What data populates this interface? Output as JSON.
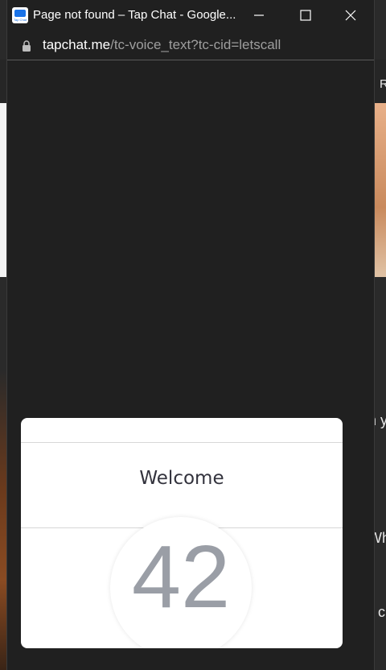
{
  "window": {
    "title": "Page not found – Tap Chat - Google...",
    "favicon_text": "Tap Chat"
  },
  "address": {
    "host": "tapchat.me",
    "path": "/tc-voice_text?tc-cid=letscall"
  },
  "background_page": {
    "snippet_1": "R",
    "snippet_2": "n y",
    "snippet_3": "Wh",
    "snippet_4": "c"
  },
  "modal": {
    "welcome_text": "Welcome",
    "counter": "42"
  },
  "colors": {
    "window_bg": "#202020",
    "card_bg": "#ffffff",
    "counter_color": "#9a9ea6"
  }
}
